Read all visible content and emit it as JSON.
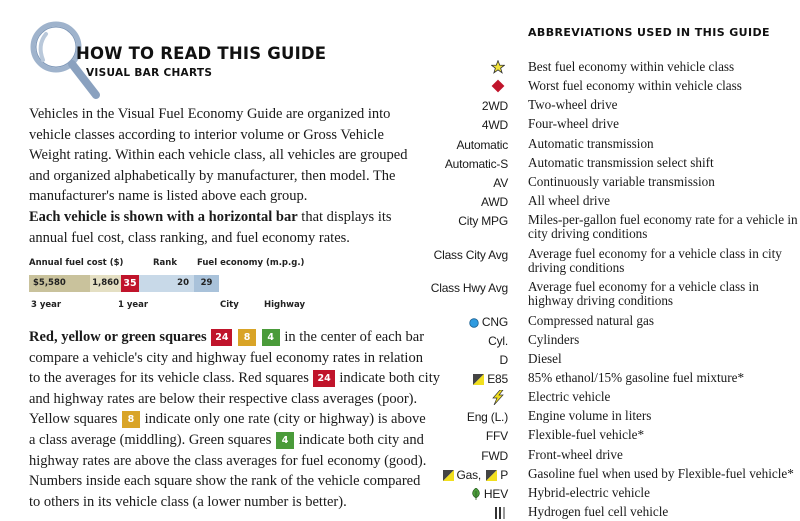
{
  "header": {
    "title": "HOW TO READ THIS GUIDE",
    "subtitle": "VISUAL BAR CHARTS"
  },
  "intro": {
    "paragraph1": "Vehicles in the Visual Fuel Economy Guide are organized into vehicle classes according to interior volume or Gross Vehicle Weight rating. Within each vehicle class, all vehicles are grouped and organized alphabetically by manufacturer, then model. The manufacturer's name is listed above each group.",
    "paragraph2_bold": "Each vehicle is shown with a horizontal bar",
    "paragraph2_rest": " that displays its annual fuel cost, class ranking, and fuel economy rates."
  },
  "sample_bar": {
    "labels_top": {
      "annual_fuel_cost": "Annual fuel cost ($)",
      "rank": "Rank",
      "fuel_economy": "Fuel economy (m.p.g.)"
    },
    "values": {
      "three_year": "$5,580",
      "one_year": "1,860",
      "rank": "35",
      "city": "20",
      "highway": "29"
    },
    "labels_bottom": {
      "three_year": "3 year",
      "one_year": "1 year",
      "city": "City",
      "highway": "Highway"
    },
    "colors": {
      "three_year": "#c9c29c",
      "one_year": "#e4dfc3",
      "rank_red": "#c0142b",
      "city": "#c8d9e8",
      "highway": "#a9c2da"
    }
  },
  "squares_explanation": {
    "lead_bold": "Red, yellow or green squares",
    "sample_red": "24",
    "sample_yellow": "8",
    "sample_green": "4",
    "line1_rest": " in the center of each bar",
    "line2": "compare a vehicle's city and highway fuel economy rates in relation",
    "line3_a": "to the averages for its vehicle class. Red squares ",
    "line3_b": " indicate both city",
    "line4": "and highway rates are below their respective class averages (poor).",
    "line5_a": "Yellow squares ",
    "line5_b": " indicate only one rate (city or highway) is above",
    "line6_a": "a class average (middling). Green squares ",
    "line6_b": " indicate both city and",
    "line7": "highway rates are above the class averages for fuel economy (good).",
    "line8": "Numbers inside each square show the rank of the vehicle compared",
    "line9": "to others in its vehicle class (a lower number is better).",
    "colors": {
      "red": "#c0142b",
      "yellow": "#d9a427",
      "green": "#4a9b3a"
    }
  },
  "abbreviations": {
    "title": "ABBREVIATIONS USED IN THIS GUIDE",
    "items": [
      {
        "key": "",
        "icon": "star-icon",
        "definition": "Best fuel economy within vehicle class"
      },
      {
        "key": "",
        "icon": "red-diamond-icon",
        "definition": "Worst fuel economy within vehicle class"
      },
      {
        "key": "2WD",
        "definition": "Two-wheel drive"
      },
      {
        "key": "4WD",
        "definition": "Four-wheel drive"
      },
      {
        "key": "Automatic",
        "definition": "Automatic transmission"
      },
      {
        "key": "Automatic-S",
        "definition": "Automatic transmission select shift"
      },
      {
        "key": "AV",
        "definition": "Continuously variable transmission"
      },
      {
        "key": "AWD",
        "definition": "All wheel drive"
      },
      {
        "key": "City MPG",
        "definition": "Miles-per-gallon fuel economy rate for a vehicle in city driving conditions"
      },
      {
        "key": "Class City Avg",
        "definition": "Average fuel economy for a vehicle class in city driving conditions"
      },
      {
        "key": "Class Hwy Avg",
        "definition": "Average fuel economy for a vehicle class in highway driving conditions"
      },
      {
        "key": "CNG",
        "icon": "blue-dot-icon",
        "definition": "Compressed natural gas"
      },
      {
        "key": "Cyl.",
        "definition": "Cylinders"
      },
      {
        "key": "D",
        "definition": "Diesel"
      },
      {
        "key": "E85",
        "icon": "flex-fuel-e85-icon",
        "definition": "85% ethanol/15% gasoline fuel mixture*"
      },
      {
        "key": "",
        "icon": "lightning-bolt-icon",
        "definition": "Electric vehicle"
      },
      {
        "key": "Eng (L.)",
        "definition": "Engine volume in liters"
      },
      {
        "key": "FFV",
        "definition": "Flexible-fuel vehicle*"
      },
      {
        "key": "FWD",
        "definition": "Front-wheel drive"
      },
      {
        "key_a": "Gas,",
        "key_b": "P",
        "icon": "flex-fuel-gas-icon",
        "definition": "Gasoline fuel when used by Flexible-fuel vehicle*"
      },
      {
        "key": "HEV",
        "icon": "leaf-icon",
        "definition": "Hybrid-electric vehicle"
      },
      {
        "key": "",
        "icon": "hydrogen-icon",
        "definition": "Hydrogen fuel cell vehicle"
      }
    ]
  }
}
